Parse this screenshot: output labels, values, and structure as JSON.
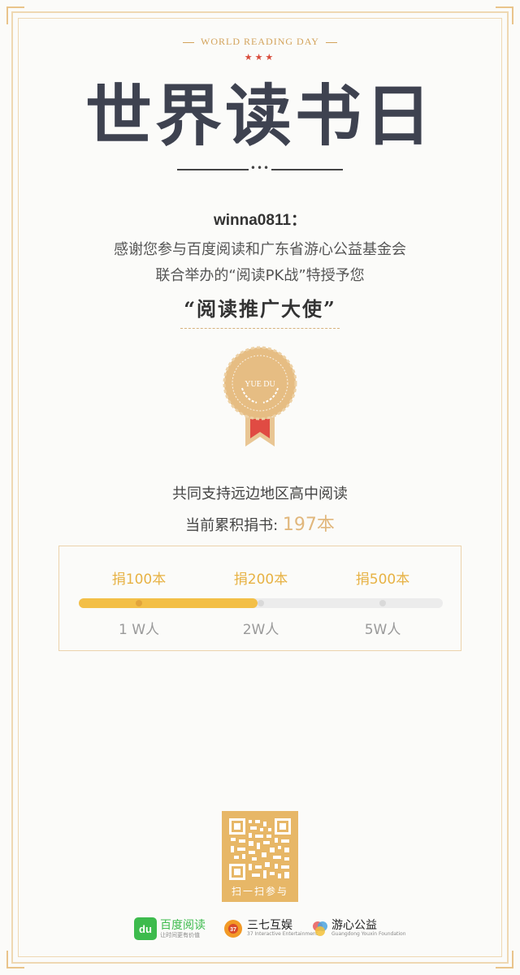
{
  "header": {
    "subtitle": "WORLD READING DAY",
    "stars": "★★★",
    "title": "世界读书日"
  },
  "certificate": {
    "username": "winna0811：",
    "thanks_line1": "感谢您参与百度阅读和广东省游心公益基金会",
    "thanks_line2": "联合举办的“阅读PK战”特授予您",
    "award_title": "“阅读推广大使”",
    "badge_text": "YUE DU"
  },
  "donation": {
    "support_text": "共同支持远边地区高中阅读",
    "current_label": "当前累积捐书: ",
    "current_value": "197本",
    "progress_fraction": 0.49,
    "milestones": [
      {
        "donate": "捐100本",
        "people": "1 W人"
      },
      {
        "donate": "捐200本",
        "people": "2W人"
      },
      {
        "donate": "捐500本",
        "people": "5W人"
      }
    ]
  },
  "qr": {
    "caption": "扫一扫参与"
  },
  "footer": {
    "logos": [
      {
        "mark": "du",
        "name": "百度阅读",
        "sub": "让时间更有价值"
      },
      {
        "mark": "37",
        "name": "三七互娱",
        "sub": "37 Interactive Entertainment"
      },
      {
        "mark": "yx",
        "name": "游心公益",
        "sub": "Guangdong Youxin Foundation"
      }
    ]
  },
  "colors": {
    "gold": "#e1b77c",
    "progress_fill": "#f3bf47",
    "title_dark": "#3e4250",
    "star_red": "#d84b3b",
    "ribbon_red": "#e04b43"
  }
}
